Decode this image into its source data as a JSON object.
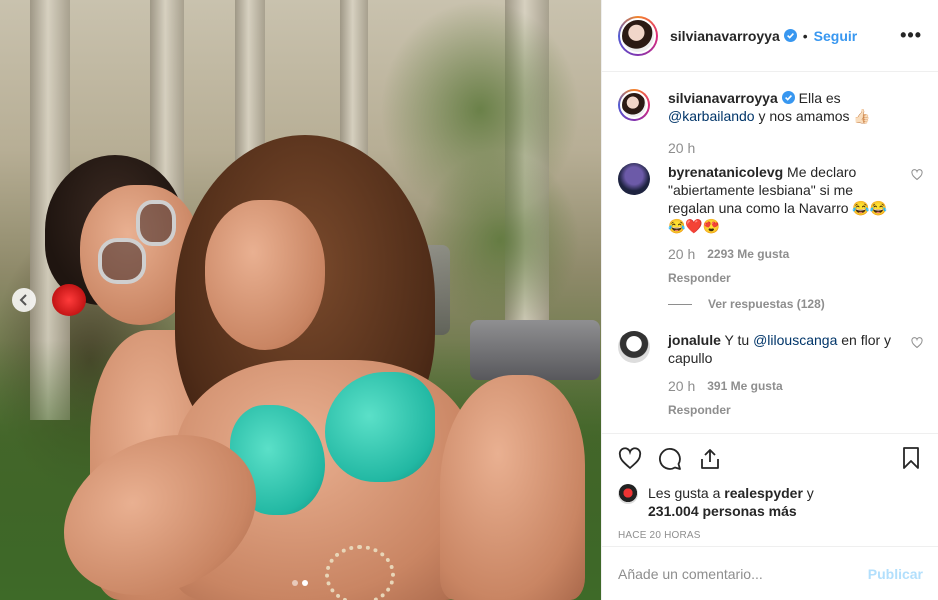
{
  "post": {
    "username": "silvianavarroyya",
    "follow_label": "Seguir",
    "more_label": "•••",
    "caption": {
      "username": "silvianavarroyya",
      "text_before": "Ella es ",
      "mention": "@karbailando",
      "text_after": " y nos amamos 👍🏻",
      "time": "20 h"
    },
    "comments": [
      {
        "username": "byrenatanicolevg",
        "text": "Me declaro \"abiertamente lesbiana\" si me regalan una como la Navarro 😂😂😂❤️😍",
        "time": "20 h",
        "likes": "2293 Me gusta",
        "reply": "Responder",
        "view_replies": "Ver respuestas (128)"
      },
      {
        "username": "jonalule",
        "text_before": "Y tu ",
        "mention": "@lilouscanga",
        "text_after": " en flor y capullo",
        "time": "20 h",
        "likes": "391 Me gusta",
        "reply": "Responder"
      }
    ],
    "liked_by": {
      "prefix": "Les gusta a ",
      "user": "realespyder",
      "conj": " y",
      "others": "231.004 personas más"
    },
    "posted_ago": "HACE 20 HORAS",
    "comment_input": {
      "placeholder": "Añade un comentario...",
      "value": ""
    },
    "publish_label": "Publicar",
    "carousel": {
      "count": 2,
      "active_index": 1
    }
  },
  "icons": {
    "like": "heart-icon",
    "comment": "comment-icon",
    "share": "share-icon",
    "save": "bookmark-icon",
    "verified": "verified-badge-icon",
    "prev": "chevron-left-icon"
  },
  "colors": {
    "link": "#3897f0",
    "mention": "#003569",
    "muted": "#8e8e8e",
    "publish_disabled": "#b2dffc"
  }
}
